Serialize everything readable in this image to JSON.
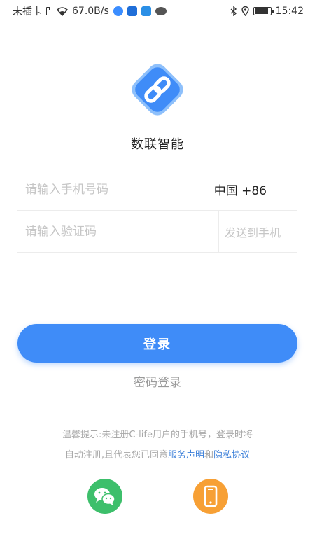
{
  "status_bar": {
    "carrier": "未插卡",
    "speed": "67.0B/s",
    "time": "15:42",
    "battery_level": 0.9
  },
  "app": {
    "name": "数联智能",
    "brand_color": "#3f8cf8"
  },
  "form": {
    "phone_placeholder": "请输入手机号码",
    "country_code": "中国 +86",
    "code_placeholder": "请输入验证码",
    "send_code_label": "发送到手机"
  },
  "actions": {
    "login_label": "登录",
    "password_login_label": "密码登录"
  },
  "terms": {
    "line1": "温馨提示:未注册C-life用户的手机号，登录时将",
    "line2_prefix": "自动注册,且代表您已同意",
    "service_link": "服务声明",
    "conjunction": "和",
    "privacy_link": "隐私协议"
  },
  "social": {
    "wechat_icon": "wechat-icon",
    "phone_icon": "phone-icon"
  }
}
